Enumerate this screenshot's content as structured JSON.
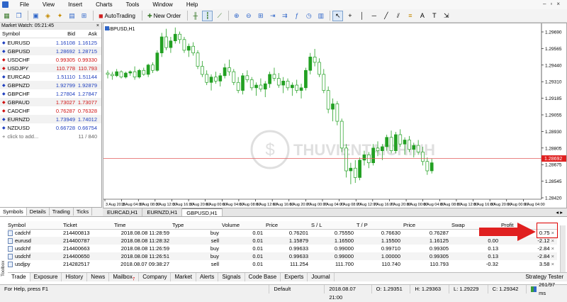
{
  "menu": [
    "File",
    "View",
    "Insert",
    "Charts",
    "Tools",
    "Window",
    "Help"
  ],
  "toolbar": {
    "autotrading": "AutoTrading",
    "new_order": "New Order"
  },
  "market_watch": {
    "title": "Market Watch: 05:21:45",
    "headers": {
      "symbol": "Symbol",
      "bid": "Bid",
      "ask": "Ask"
    },
    "rows": [
      {
        "symbol": "EURUSD",
        "bid": "1.16108",
        "ask": "1.16125",
        "dir": "up"
      },
      {
        "symbol": "GBPUSD",
        "bid": "1.28692",
        "ask": "1.28715",
        "dir": "up"
      },
      {
        "symbol": "USDCHF",
        "bid": "0.99305",
        "ask": "0.99330",
        "dir": "down"
      },
      {
        "symbol": "USDJPY",
        "bid": "110.778",
        "ask": "110.793",
        "dir": "down"
      },
      {
        "symbol": "EURCAD",
        "bid": "1.51110",
        "ask": "1.51144",
        "dir": "up"
      },
      {
        "symbol": "GBPNZD",
        "bid": "1.92799",
        "ask": "1.92879",
        "dir": "up"
      },
      {
        "symbol": "GBPCHF",
        "bid": "1.27804",
        "ask": "1.27847",
        "dir": "up"
      },
      {
        "symbol": "GBPAUD",
        "bid": "1.73027",
        "ask": "1.73077",
        "dir": "down"
      },
      {
        "symbol": "CADCHF",
        "bid": "0.76287",
        "ask": "0.76328",
        "dir": "down"
      },
      {
        "symbol": "EURNZD",
        "bid": "1.73949",
        "ask": "1.74012",
        "dir": "up"
      },
      {
        "symbol": "NZDUSD",
        "bid": "0.66728",
        "ask": "0.66754",
        "dir": "up"
      }
    ],
    "add_label": "click to add...",
    "count": "11 / 840",
    "tabs": [
      "Symbols",
      "Details",
      "Trading",
      "Ticks"
    ]
  },
  "chart": {
    "title": "GBPUSD,H1",
    "watermark": "THUVIENTAICHINH",
    "price_label": "1.28692",
    "y_ticks": [
      "1.29690",
      "1.29565",
      "1.29440",
      "1.29310",
      "1.29185",
      "1.29055",
      "1.28930",
      "1.28805",
      "1.28675",
      "1.28545",
      "1.28420"
    ],
    "x_ticks": [
      "3 Aug 2018",
      "3 Aug 04:00",
      "3 Aug 08:00",
      "3 Aug 12:00",
      "3 Aug 16:00",
      "3 Aug 20:00",
      "6 Aug 00:00",
      "6 Aug 04:00",
      "6 Aug 08:00",
      "6 Aug 12:00",
      "6 Aug 16:00",
      "6 Aug 20:00",
      "7 Aug 00:00",
      "7 Aug 04:00",
      "7 Aug 08:00",
      "7 Aug 12:00",
      "7 Aug 16:00",
      "7 Aug 20:00",
      "8 Aug 00:00",
      "8 Aug 04:00",
      "8 Aug 08:00",
      "8 Aug 12:00",
      "8 Aug 16:00",
      "8 Aug 20:00",
      "9 Aug 00:00",
      "9 Aug 04:00"
    ]
  },
  "chart_tabs": [
    "EURCAD,H1",
    "EURNZD,H1",
    "GBPUSD,H1"
  ],
  "trade": {
    "headers": [
      "Symbol",
      "Ticket",
      "Time",
      "Type",
      "Volume",
      "Price",
      "S / L",
      "T / P",
      "Price",
      "Swap",
      "Profit"
    ],
    "rows": [
      [
        "cadchf",
        "214400813",
        "2018.08.08 11:28:59",
        "buy",
        "0.01",
        "0.76201",
        "0.75550",
        "0.76630",
        "0.76287",
        "0.00",
        "0.75"
      ],
      [
        "eurusd",
        "214400787",
        "2018.08.08 11:28:32",
        "sell",
        "0.01",
        "1.15879",
        "1.16500",
        "1.15500",
        "1.16125",
        "0.00",
        "-2.12"
      ],
      [
        "usdchf",
        "214400663",
        "2018.08.08 11:26:59",
        "buy",
        "0.01",
        "0.99633",
        "0.99000",
        "0.99710",
        "0.99305",
        "0.13",
        "-2.84"
      ],
      [
        "usdchf",
        "214400650",
        "2018.08.08 11:26:51",
        "buy",
        "0.01",
        "0.99633",
        "0.99000",
        "1.00000",
        "0.99305",
        "0.13",
        "-2.84"
      ],
      [
        "usdjpy",
        "214282517",
        "2018.08.07 09:38:27",
        "sell",
        "0.01",
        "111.254",
        "111.700",
        "110.740",
        "110.793",
        "-0.32",
        "3.58"
      ]
    ]
  },
  "terminal_tabs": [
    "Trade",
    "Exposure",
    "History",
    "News",
    "Mailbox",
    "Company",
    "Market",
    "Alerts",
    "Signals",
    "Code Base",
    "Experts",
    "Journal"
  ],
  "mailbox_badge": "7",
  "strategy_tester": "Strategy Tester",
  "toolbox_label": "Toolbox",
  "status": {
    "help": "For Help, press F1",
    "profile": "Default",
    "time": "2018.08.07 21:00",
    "open": "O: 1.29351",
    "high": "H: 1.29363",
    "low": "L: 1.29229",
    "close": "C: 1.29342",
    "traffic": "261/97 ms"
  },
  "chart_data": {
    "type": "candlestick",
    "title": "GBPUSD,H1",
    "x_ticks": [
      "3 Aug 2018",
      "3 Aug 04:00",
      "3 Aug 08:00",
      "3 Aug 12:00",
      "3 Aug 16:00",
      "3 Aug 20:00",
      "6 Aug 00:00",
      "6 Aug 04:00",
      "6 Aug 08:00",
      "6 Aug 12:00",
      "6 Aug 16:00",
      "6 Aug 20:00",
      "7 Aug 00:00",
      "7 Aug 04:00",
      "7 Aug 08:00",
      "7 Aug 12:00",
      "7 Aug 16:00",
      "7 Aug 20:00",
      "8 Aug 00:00",
      "8 Aug 04:00",
      "8 Aug 08:00",
      "8 Aug 12:00",
      "8 Aug 16:00",
      "8 Aug 20:00",
      "9 Aug 00:00",
      "9 Aug 04:00"
    ],
    "ylim": [
      1.2842,
      1.2969
    ],
    "candles": [
      [
        1.2933,
        1.2935,
        1.2929,
        1.2932
      ],
      [
        1.2932,
        1.2934,
        1.2928,
        1.2931
      ],
      [
        1.2931,
        1.2936,
        1.293,
        1.2934
      ],
      [
        1.2934,
        1.2935,
        1.2929,
        1.293
      ],
      [
        1.293,
        1.2934,
        1.2929,
        1.2933
      ],
      [
        1.2933,
        1.2935,
        1.2931,
        1.2934
      ],
      [
        1.2934,
        1.2938,
        1.2928,
        1.293
      ],
      [
        1.293,
        1.2936,
        1.2929,
        1.2935
      ],
      [
        1.2935,
        1.2937,
        1.2931,
        1.2932
      ],
      [
        1.2932,
        1.294,
        1.293,
        1.2939
      ],
      [
        1.2939,
        1.2941,
        1.2933,
        1.2935
      ],
      [
        1.2935,
        1.295,
        1.2934,
        1.2948
      ],
      [
        1.2948,
        1.2963,
        1.2945,
        1.296
      ],
      [
        1.296,
        1.2966,
        1.295,
        1.2952
      ],
      [
        1.2952,
        1.296,
        1.2948,
        1.2957
      ],
      [
        1.2957,
        1.2967,
        1.2955,
        1.2962
      ],
      [
        1.2962,
        1.2964,
        1.2955,
        1.2958
      ],
      [
        1.2958,
        1.296,
        1.2948,
        1.295
      ],
      [
        1.295,
        1.2955,
        1.2945,
        1.2953
      ],
      [
        1.2953,
        1.2956,
        1.2946,
        1.2948
      ],
      [
        1.2948,
        1.295,
        1.2936,
        1.2938
      ],
      [
        1.2938,
        1.2942,
        1.293,
        1.2932
      ],
      [
        1.2932,
        1.2935,
        1.2924,
        1.2926
      ],
      [
        1.2926,
        1.2932,
        1.292,
        1.293
      ],
      [
        1.293,
        1.2934,
        1.2925,
        1.2927
      ],
      [
        1.2927,
        1.2933,
        1.2923,
        1.2931
      ],
      [
        1.2931,
        1.294,
        1.2929,
        1.2937
      ],
      [
        1.2937,
        1.2943,
        1.2931,
        1.2934
      ],
      [
        1.2934,
        1.2936,
        1.2924,
        1.2926
      ],
      [
        1.2926,
        1.293,
        1.2918,
        1.292
      ],
      [
        1.292,
        1.2933,
        1.2917,
        1.2931
      ],
      [
        1.2931,
        1.2935,
        1.2926,
        1.2928
      ],
      [
        1.2928,
        1.293,
        1.292,
        1.2922
      ],
      [
        1.2922,
        1.2926,
        1.2916,
        1.2924
      ],
      [
        1.2924,
        1.2929,
        1.2919,
        1.2921
      ],
      [
        1.2921,
        1.2927,
        1.2915,
        1.2925
      ],
      [
        1.2925,
        1.2934,
        1.2922,
        1.2932
      ],
      [
        1.2932,
        1.2937,
        1.2927,
        1.2929
      ],
      [
        1.2929,
        1.2933,
        1.2922,
        1.2924
      ],
      [
        1.2924,
        1.293,
        1.2918,
        1.2927
      ],
      [
        1.2927,
        1.2929,
        1.292,
        1.2922
      ],
      [
        1.2922,
        1.2926,
        1.2916,
        1.2924
      ],
      [
        1.2924,
        1.2928,
        1.2918,
        1.292
      ],
      [
        1.292,
        1.2925,
        1.2914,
        1.2922
      ],
      [
        1.2922,
        1.2937,
        1.292,
        1.2935
      ],
      [
        1.2935,
        1.2948,
        1.2932,
        1.2945
      ],
      [
        1.2945,
        1.2951,
        1.2938,
        1.2941
      ],
      [
        1.2941,
        1.2944,
        1.293,
        1.2932
      ],
      [
        1.2932,
        1.2936,
        1.2918,
        1.292
      ],
      [
        1.292,
        1.2923,
        1.2903,
        1.2906
      ],
      [
        1.2906,
        1.2914,
        1.2897,
        1.291
      ],
      [
        1.291,
        1.2912,
        1.2894,
        1.2897
      ],
      [
        1.2897,
        1.2899,
        1.2874,
        1.2877
      ],
      [
        1.2877,
        1.288,
        1.2855,
        1.286
      ],
      [
        1.286,
        1.2866,
        1.285,
        1.2862
      ],
      [
        1.2862,
        1.2868,
        1.2851,
        1.2855
      ],
      [
        1.2855,
        1.287,
        1.2853,
        1.2868
      ],
      [
        1.2868,
        1.2875,
        1.2864,
        1.2872
      ],
      [
        1.2872,
        1.2874,
        1.2862,
        1.2866
      ],
      [
        1.2866,
        1.288,
        1.2864,
        1.2877
      ],
      [
        1.2877,
        1.2882,
        1.2871,
        1.2875
      ],
      [
        1.2875,
        1.288,
        1.2868,
        1.2878
      ],
      [
        1.2878,
        1.2887,
        1.2875,
        1.2885
      ],
      [
        1.2885,
        1.289,
        1.2873,
        1.2875
      ],
      [
        1.2875,
        1.2889,
        1.2873,
        1.2887
      ],
      [
        1.2887,
        1.2891,
        1.2878,
        1.288
      ],
      [
        1.288,
        1.2885,
        1.2872,
        1.2883
      ],
      [
        1.2883,
        1.2886,
        1.2874,
        1.2876
      ],
      [
        1.2876,
        1.2881,
        1.287,
        1.2879
      ],
      [
        1.2879,
        1.2883,
        1.2872,
        1.2874
      ],
      [
        1.2874,
        1.2878,
        1.2864,
        1.2867
      ],
      [
        1.2867,
        1.287,
        1.2857,
        1.286
      ],
      [
        1.286,
        1.2869,
        1.2858,
        1.2866
      ]
    ]
  }
}
